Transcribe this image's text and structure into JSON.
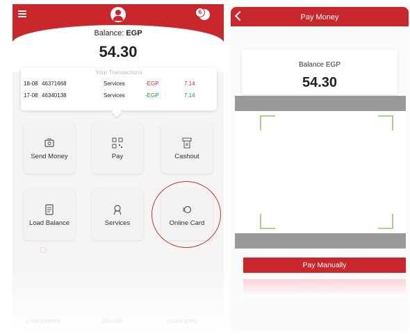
{
  "left": {
    "header": {
      "menu_icon": "menu-icon",
      "avatar_icon": "user-avatar-icon",
      "notification_count": "6",
      "notification_icon": "bell-icon"
    },
    "balance": {
      "label": "Balance:",
      "currency": "EGP",
      "value": "54.30"
    },
    "transactions": {
      "title": "Your Transactions",
      "rows": [
        {
          "date": "18-08",
          "id": "46371668",
          "type": "Services",
          "currency": "-EGP",
          "amount": "7.14",
          "color": "#e0262b"
        },
        {
          "date": "17-08",
          "id": "46340138",
          "type": "Services",
          "currency": "-EGP",
          "amount": "7.14",
          "color": "#1a9a33"
        }
      ]
    },
    "tiles": [
      {
        "label": "Send Money",
        "icon": "send-money-icon"
      },
      {
        "label": "Pay",
        "icon": "qr-pay-icon"
      },
      {
        "label": "Cashout",
        "icon": "cashout-icon"
      },
      {
        "label": "Load Balance",
        "icon": "load-balance-icon"
      },
      {
        "label": "Services",
        "icon": "services-icon"
      },
      {
        "label": "Online Card",
        "icon": "online-card-icon"
      }
    ],
    "ghost_labels": [
      "Load Balance",
      "Services",
      "Online Card"
    ]
  },
  "right": {
    "title": "Pay Money",
    "back_icon": "chevron-left-icon",
    "balance_label": "Balance EGP",
    "balance_value": "54.30",
    "pay_manually": "Pay Manually"
  },
  "colors": {
    "brand": "#c8282c",
    "debit": "#e0262b",
    "credit": "#1a9a33",
    "scan_corner": "#a9d18e",
    "scan_band": "#999999"
  }
}
